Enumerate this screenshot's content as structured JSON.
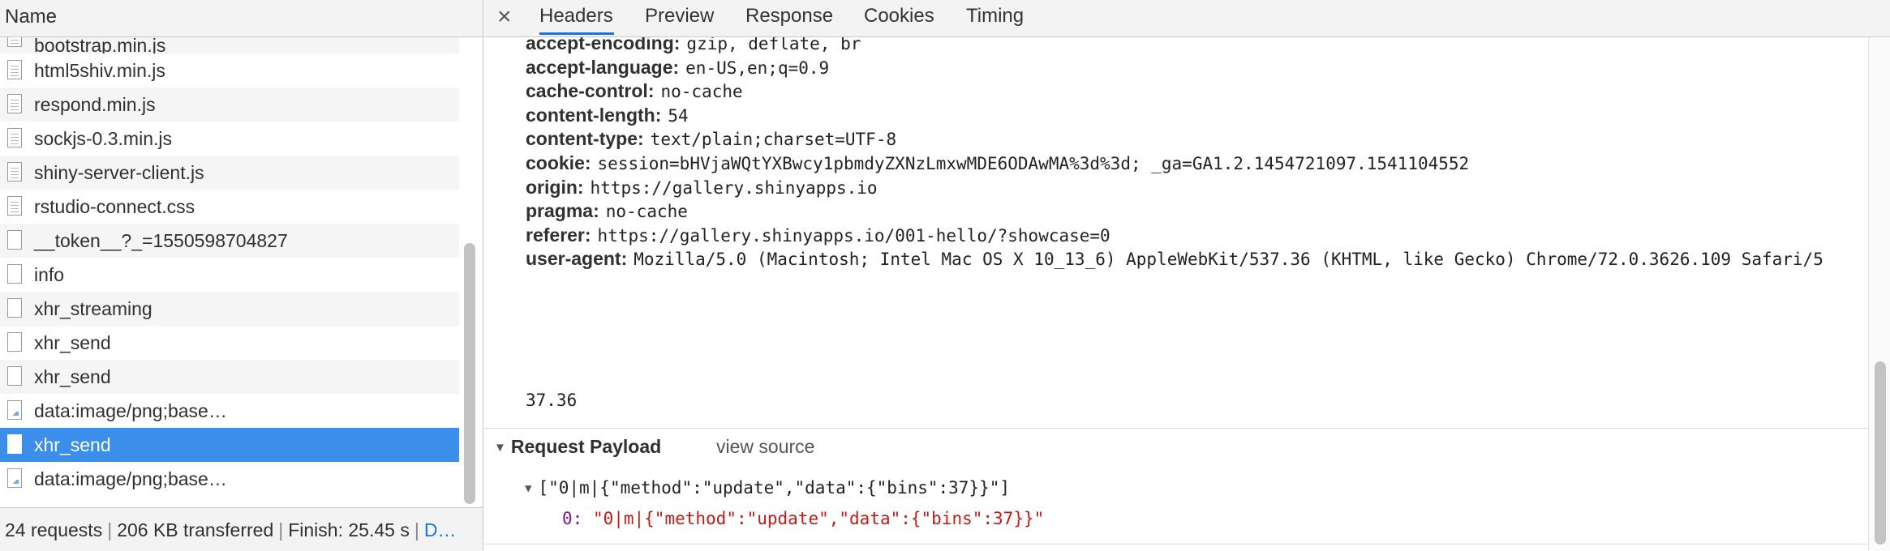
{
  "left_panel": {
    "header": "Name",
    "files": [
      {
        "name": "bootstrap.min.js",
        "icon": "script-file-icon"
      },
      {
        "name": "html5shiv.min.js",
        "icon": "script-file-icon"
      },
      {
        "name": "respond.min.js",
        "icon": "script-file-icon"
      },
      {
        "name": "sockjs-0.3.min.js",
        "icon": "script-file-icon"
      },
      {
        "name": "shiny-server-client.js",
        "icon": "script-file-icon"
      },
      {
        "name": "rstudio-connect.css",
        "icon": "script-file-icon"
      },
      {
        "name": "__token__?_=1550598704827",
        "icon": "blank-file-icon"
      },
      {
        "name": "info",
        "icon": "blank-file-icon"
      },
      {
        "name": "xhr_streaming",
        "icon": "blank-file-icon"
      },
      {
        "name": "xhr_send",
        "icon": "blank-file-icon"
      },
      {
        "name": "xhr_send",
        "icon": "blank-file-icon"
      },
      {
        "name": "data:image/png;base…",
        "icon": "image-file-icon"
      },
      {
        "name": "xhr_send",
        "icon": "blank-file-icon",
        "selected": true
      },
      {
        "name": "data:image/png;base…",
        "icon": "image-file-icon"
      }
    ],
    "status": {
      "requests": "24 requests",
      "transferred": "206 KB transferred",
      "finish": "Finish: 25.45 s",
      "more": "D…"
    }
  },
  "right_panel": {
    "close_symbol": "×",
    "tabs": [
      "Headers",
      "Preview",
      "Response",
      "Cookies",
      "Timing"
    ],
    "active_tab": "Headers",
    "headers": [
      {
        "name": "accept-encoding:",
        "value": "gzip, deflate, br"
      },
      {
        "name": "accept-language:",
        "value": "en-US,en;q=0.9"
      },
      {
        "name": "cache-control:",
        "value": "no-cache"
      },
      {
        "name": "content-length:",
        "value": "54"
      },
      {
        "name": "content-type:",
        "value": "text/plain;charset=UTF-8"
      },
      {
        "name": "cookie:",
        "value": "session=bHVjaWQtYXBwcy1pbmdyZXNzLmxwMDE6ODAwMA%3d%3d; _ga=GA1.2.1454721097.1541104552"
      },
      {
        "name": "origin:",
        "value": "https://gallery.shinyapps.io"
      },
      {
        "name": "pragma:",
        "value": "no-cache"
      },
      {
        "name": "referer:",
        "value": "https://gallery.shinyapps.io/001-hello/?showcase=0"
      },
      {
        "name": "user-agent:",
        "value": "Mozilla/5.0 (Macintosh; Intel Mac OS X 10_13_6) AppleWebKit/537.36 (KHTML, like Gecko) Chrome/72.0.3626.109 Safari/5"
      }
    ],
    "user_agent_continuation": "37.36",
    "payload": {
      "title": "Request Payload",
      "view_source": "view source",
      "array_summary": "[\"0|m|{\"method\":\"update\",\"data\":{\"bins\":37}}\"]",
      "item_index": "0:",
      "item_value": "\"0|m|{\"method\":\"update\",\"data\":{\"bins\":37}}\""
    }
  }
}
